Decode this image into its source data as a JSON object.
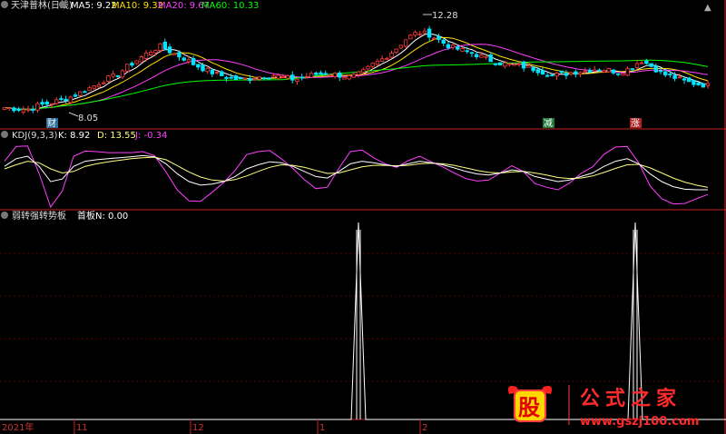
{
  "header": {
    "stock_name": "天津普林(日线)",
    "ma5": "MA5: 9.22",
    "ma10": "MA10: 9.32",
    "ma20": "MA20: 9.67",
    "ma60": "MA60: 10.33"
  },
  "kdj_header": {
    "name": "KDJ(9,3,3)",
    "k": "K: 8.92",
    "d": "D: 13.55",
    "j": "J: -0.34"
  },
  "indicator_header": {
    "name": "弱转强转势板",
    "value": "首板N: 0.00"
  },
  "annotations": {
    "high": "12.28",
    "low": "8.05",
    "tag_cai": "财",
    "tag_jian": "减",
    "tag_zhang": "涨"
  },
  "x_axis": {
    "year": "2021年",
    "ticks": [
      "11",
      "12",
      "1",
      "2"
    ]
  },
  "watermark": {
    "logo": "股",
    "site_name": "公式之家",
    "url": "www.gszj100.com"
  },
  "colors": {
    "background": "#000000",
    "up": "#ff3b3b",
    "down": "#00e5ff",
    "ma5": "#ffffff",
    "ma10": "#ffe000",
    "ma20": "#ff40ff",
    "ma60": "#00ff00",
    "k": "#ffffff",
    "d": "#ffff80",
    "j": "#ff40ff",
    "separator": "#ff3030",
    "grid": "#8b0000"
  },
  "chart_data": [
    {
      "type": "candlestick",
      "title": "天津普林(日线)",
      "series": [
        {
          "name": "MA5",
          "last": 9.22
        },
        {
          "name": "MA10",
          "last": 9.32
        },
        {
          "name": "MA20",
          "last": 9.67
        },
        {
          "name": "MA60",
          "last": 10.33
        }
      ],
      "close_path": [
        8.2,
        8.15,
        8.1,
        8.3,
        8.4,
        8.55,
        8.7,
        8.95,
        9.2,
        9.5,
        9.7,
        10.1,
        10.45,
        10.8,
        11.05,
        10.75,
        10.5,
        10.2,
        9.95,
        9.75,
        9.6,
        9.5,
        9.55,
        9.65,
        9.7,
        9.6,
        9.5,
        9.65,
        9.75,
        9.8,
        9.7,
        9.6,
        9.8,
        10.2,
        10.5,
        10.9,
        11.4,
        11.7,
        11.6,
        11.3,
        11.0,
        10.85,
        10.7,
        10.5,
        10.3,
        10.2,
        10.15,
        10.05,
        9.9,
        9.7,
        9.75,
        9.85,
        9.9,
        10.0,
        9.95,
        9.85,
        10.0,
        10.4,
        10.1,
        9.75,
        9.6,
        9.4,
        9.3,
        9.22
      ],
      "max_price": 12.28,
      "min_price": 8.05
    },
    {
      "type": "line",
      "title": "KDJ(9,3,3)",
      "series": [
        {
          "name": "K",
          "last": 8.92
        },
        {
          "name": "D",
          "last": 13.55
        },
        {
          "name": "J",
          "last": -0.34
        }
      ],
      "k_values": [
        55,
        70,
        75,
        55,
        25,
        30,
        55,
        65,
        68,
        70,
        72,
        74,
        76,
        74,
        60,
        40,
        25,
        18,
        20,
        25,
        35,
        50,
        58,
        64,
        62,
        55,
        45,
        35,
        32,
        45,
        60,
        65,
        62,
        58,
        55,
        60,
        65,
        62,
        58,
        52,
        45,
        40,
        38,
        42,
        48,
        45,
        35,
        30,
        25,
        28,
        35,
        42,
        55,
        65,
        70,
        60,
        40,
        25,
        15,
        10,
        9,
        8.92
      ],
      "d_values": [
        50,
        58,
        65,
        62,
        50,
        42,
        45,
        55,
        60,
        64,
        67,
        70,
        72,
        73,
        68,
        56,
        44,
        34,
        28,
        26,
        29,
        36,
        45,
        53,
        58,
        57,
        53,
        47,
        41,
        42,
        48,
        54,
        57,
        57,
        56,
        57,
        60,
        61,
        60,
        57,
        52,
        47,
        43,
        42,
        44,
        45,
        42,
        38,
        33,
        31,
        32,
        36,
        43,
        51,
        58,
        59,
        52,
        42,
        32,
        24,
        18,
        13.55
      ],
      "j_values": [
        65,
        94,
        95,
        41,
        -25,
        6,
        75,
        85,
        84,
        82,
        82,
        82,
        84,
        76,
        44,
        8,
        -13,
        -14,
        4,
        23,
        47,
        78,
        84,
        86,
        70,
        51,
        29,
        11,
        14,
        51,
        84,
        87,
        72,
        60,
        53,
        66,
        75,
        64,
        54,
        42,
        31,
        26,
        28,
        42,
        56,
        45,
        21,
        14,
        9,
        22,
        41,
        54,
        79,
        93,
        94,
        62,
        16,
        -9,
        -19,
        -18,
        -9,
        -0.34
      ]
    },
    {
      "type": "line",
      "title": "弱转强转势板",
      "series": [
        {
          "name": "首板N",
          "last": 0.0
        }
      ],
      "spikes": [
        {
          "position": "late Jan",
          "value": 1
        },
        {
          "position": "last week",
          "value": 1
        }
      ]
    }
  ]
}
